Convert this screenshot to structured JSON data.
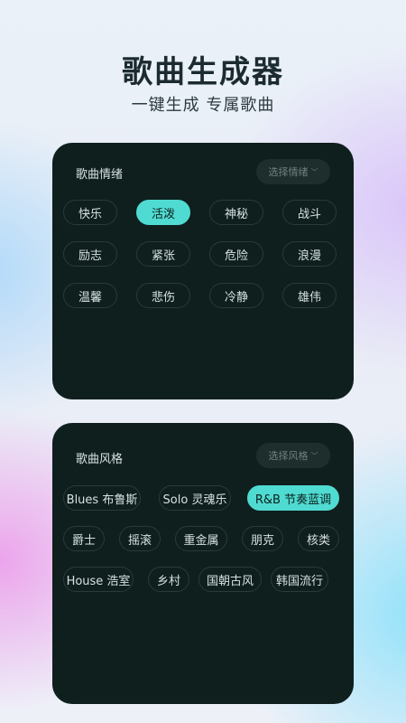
{
  "header": {
    "title": "歌曲生成器",
    "subtitle": "一键生成 专属歌曲"
  },
  "mood": {
    "label": "歌曲情绪",
    "select_label": "选择情绪",
    "selected": "活泼",
    "rows": [
      [
        "快乐",
        "活泼",
        "神秘",
        "战斗"
      ],
      [
        "励志",
        "紧张",
        "危险",
        "浪漫"
      ],
      [
        "温馨",
        "悲伤",
        "冷静",
        "雄伟"
      ]
    ]
  },
  "style": {
    "label": "歌曲风格",
    "select_label": "选择风格",
    "selected": "R&B 节奏蓝调",
    "rows": [
      [
        "Blues 布鲁斯",
        "Solo 灵魂乐",
        "R&B 节奏蓝调"
      ],
      [
        "爵士",
        "摇滚",
        "重金属",
        "朋克",
        "核类"
      ],
      [
        "House 浩室",
        "乡村",
        "国朝古风",
        "韩国流行"
      ]
    ]
  },
  "colors": {
    "accent": "#4fdbd1",
    "card_bg": "#0f1f1e",
    "title": "#1b2b30"
  }
}
